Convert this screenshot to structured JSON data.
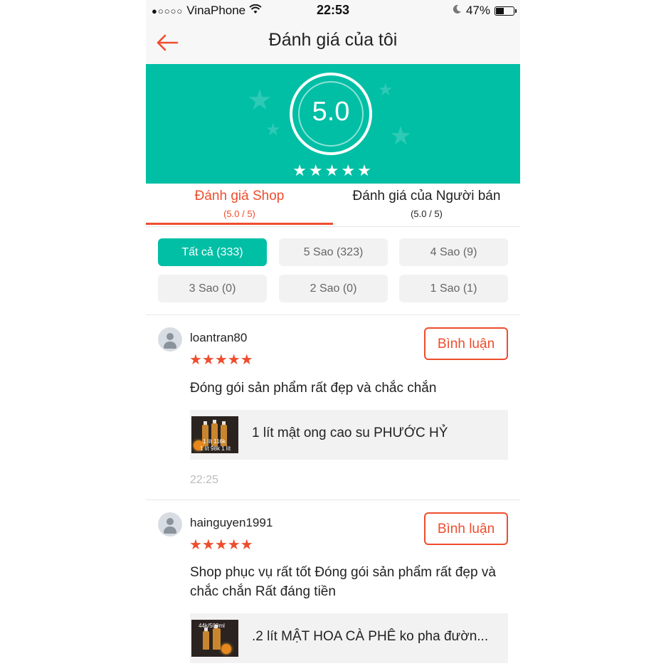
{
  "status_bar": {
    "signal_dots": "●○○○○",
    "carrier": "VinaPhone",
    "time": "22:53",
    "battery": "47%",
    "icons": [
      "wifi-icon",
      "moon-icon",
      "battery-icon"
    ]
  },
  "header": {
    "title": "Đánh giá của tôi",
    "back_icon": "arrow-left-icon"
  },
  "summary": {
    "score": "5.0",
    "stars": "★★★★★",
    "rating_fraction": 1.0
  },
  "tabs": [
    {
      "label": "Đánh giá Shop",
      "sub": "(5.0 / 5)",
      "active": true
    },
    {
      "label": "Đánh giá của Người bán",
      "sub": "(5.0 / 5)",
      "active": false
    }
  ],
  "filters": [
    {
      "label": "Tất cả (333)",
      "active": true
    },
    {
      "label": "5 Sao (323)",
      "active": false
    },
    {
      "label": "4 Sao (9)",
      "active": false
    },
    {
      "label": "3 Sao (0)",
      "active": false
    },
    {
      "label": "2 Sao (0)",
      "active": false
    },
    {
      "label": "1 Sao (1)",
      "active": false
    }
  ],
  "reviews": [
    {
      "username": "loantran80",
      "rating": 5,
      "stars": "★★★★★",
      "comment_button": "Bình luận",
      "text": "Đóng gói sản phẩm rất đẹp và chắc chắn",
      "product": {
        "name": "1 lít mật ong cao su PHƯỚC HỶ",
        "thumb_line1": "1 lít 116k",
        "thumb_line2": "1 lít  98k 1 lít"
      },
      "time": "22:25"
    },
    {
      "username": "hainguyen1991",
      "rating": 5,
      "stars": "★★★★★",
      "comment_button": "Bình luận",
      "text": "Shop phục vụ rất tốt Đóng gói sản phẩm rất đẹp và chắc chắn Rất đáng tiền",
      "product": {
        "name": ".2 lít MẬT HOA CÀ PHÊ ko pha đườn...",
        "thumb_line1": "44k/500ml"
      }
    }
  ],
  "colors": {
    "accent": "#ee4d2d",
    "teal": "#00bfa5",
    "chip_bg": "#f2f2f2",
    "header_bg": "#f7f7f7"
  }
}
